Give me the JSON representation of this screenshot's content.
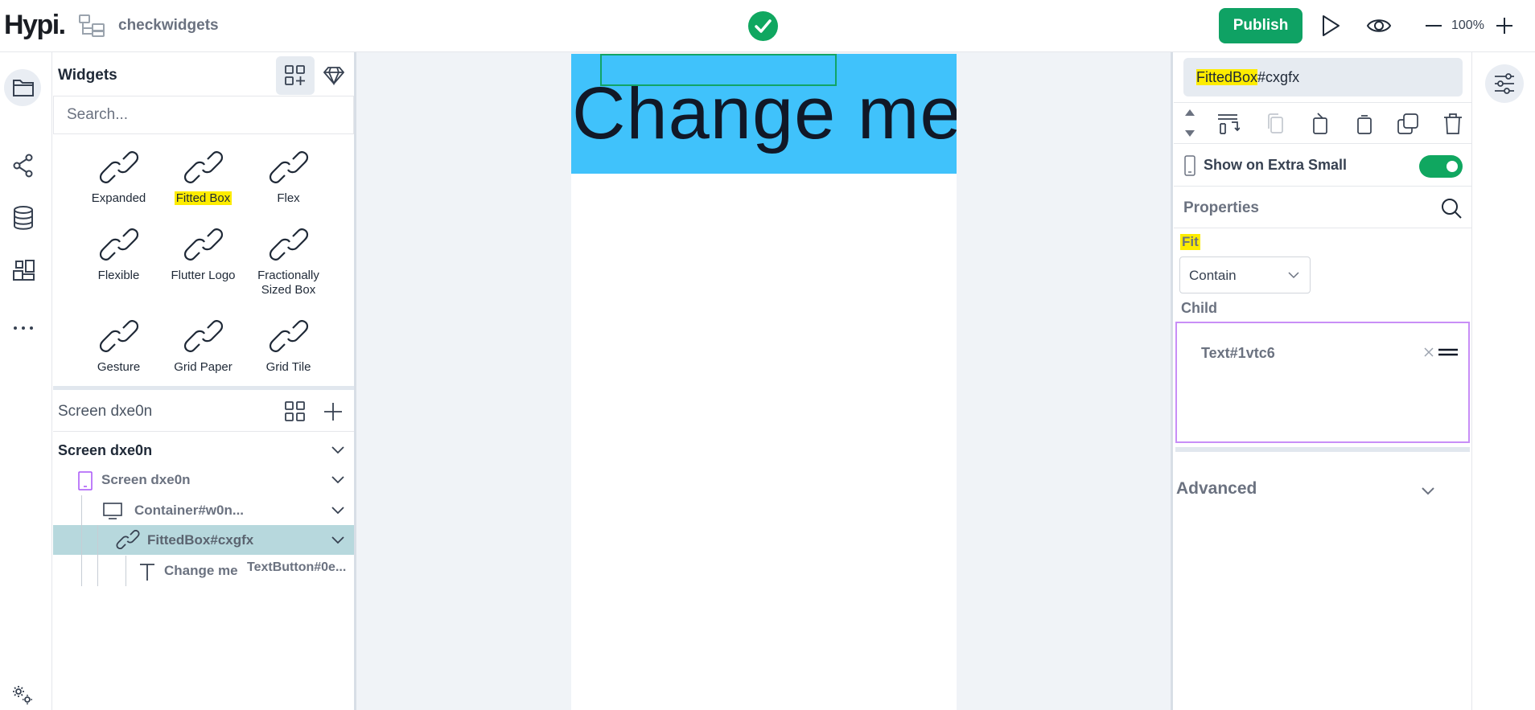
{
  "header": {
    "logo": "Hypi.",
    "project_name": "checkwidgets",
    "publish_label": "Publish",
    "zoom": "100%"
  },
  "widgets_panel": {
    "title": "Widgets",
    "search_placeholder": "Search...",
    "items": [
      {
        "label": "Expanded",
        "highlighted": false
      },
      {
        "label": "Fitted Box",
        "highlighted": true
      },
      {
        "label": "Flex",
        "highlighted": false
      },
      {
        "label": "Flexible",
        "highlighted": false
      },
      {
        "label": "Flutter Logo",
        "highlighted": false
      },
      {
        "label": "Fractionally Sized Box",
        "highlighted": false
      },
      {
        "label": "Gesture",
        "highlighted": false
      },
      {
        "label": "Grid Paper",
        "highlighted": false
      },
      {
        "label": "Grid Tile",
        "highlighted": false
      }
    ]
  },
  "tree_panel": {
    "title": "Screen dxe0n",
    "nodes": [
      {
        "label": "Screen dxe0n"
      },
      {
        "label": "Screen dxe0n"
      },
      {
        "label": "Container#w0n..."
      },
      {
        "label": "FittedBox#cxgfx"
      },
      {
        "label": "Change me"
      }
    ],
    "extra_label": "TextButton#0e..."
  },
  "canvas": {
    "banner_text": "Change me",
    "banner_color": "#40c2fb",
    "selection_color": "#11a466"
  },
  "inspector": {
    "name_highlight": "FittedBox",
    "name_rest": "#cxgfx",
    "show_label": "Show on Extra Small",
    "show_enabled": true,
    "properties_title": "Properties",
    "fit_label": "Fit",
    "fit_value": "Contain",
    "child_label": "Child",
    "child_item": "Text#1vtc6",
    "advanced_label": "Advanced"
  },
  "colors": {
    "accent_green": "#0fa264",
    "highlight_yellow": "#fdec00",
    "child_border": "#c88ef7"
  }
}
